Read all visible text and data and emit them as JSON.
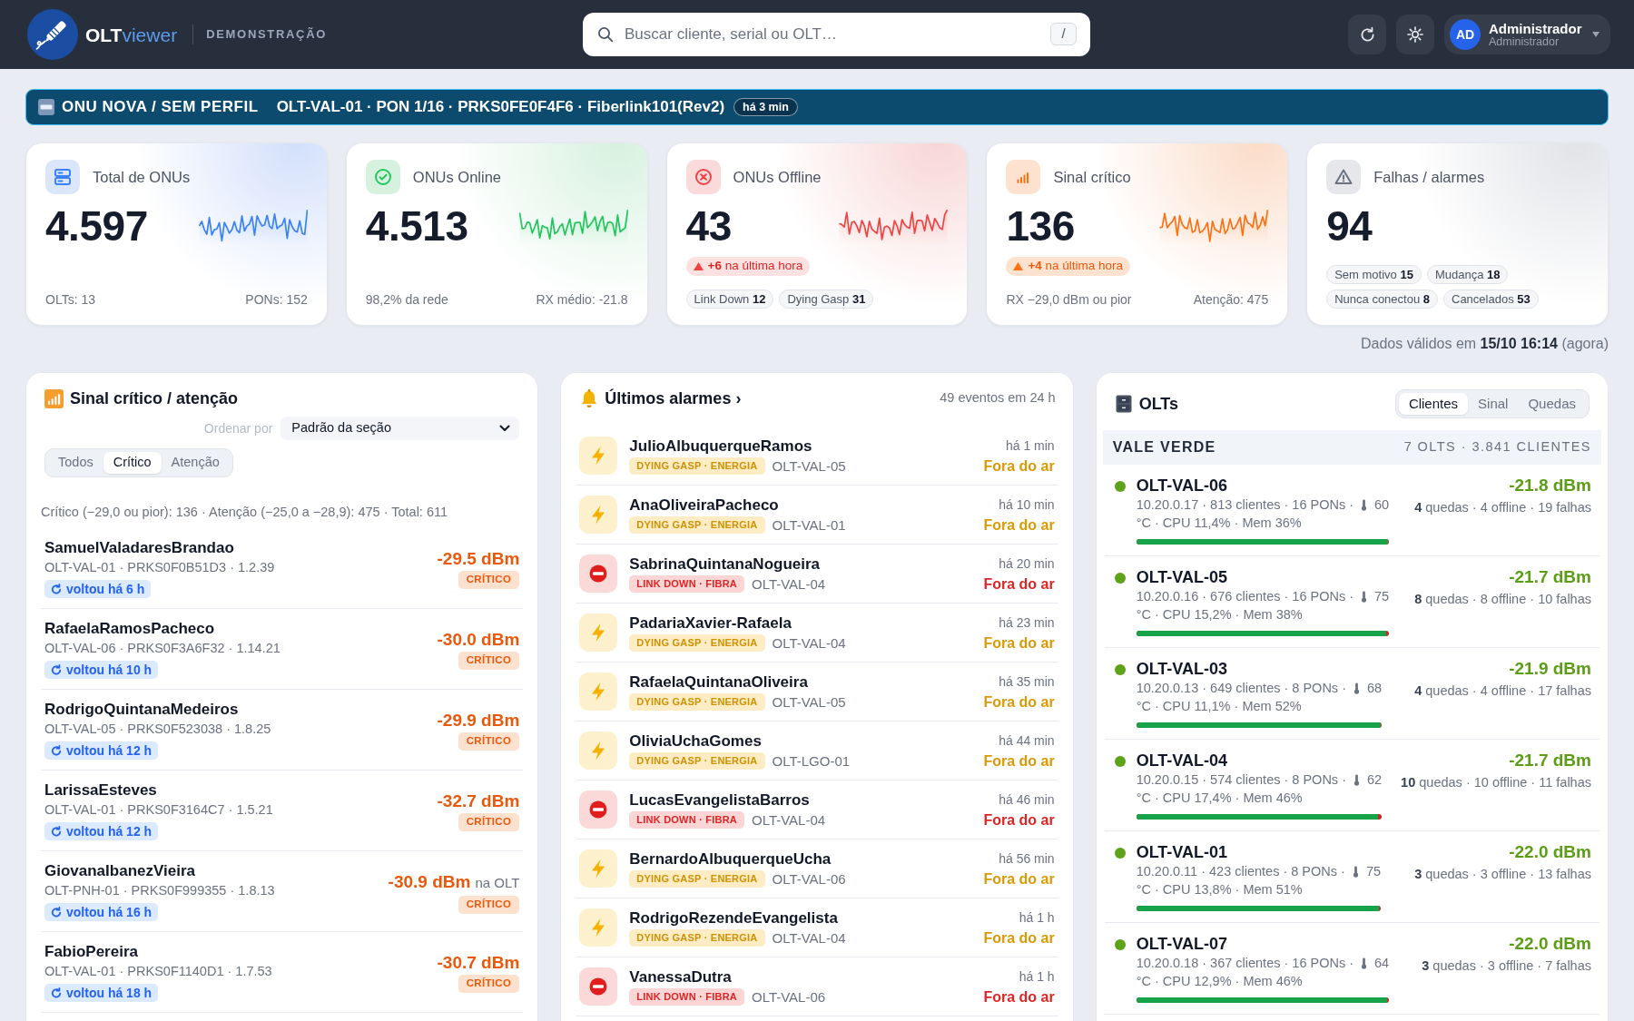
{
  "header": {
    "brand": {
      "name": "OLT",
      "suffix": "viewer"
    },
    "environment": "DEMONSTRAÇÃO",
    "search": {
      "placeholder": "Buscar cliente, serial ou OLT…",
      "shortcut": "/"
    },
    "user": {
      "initials": "AD",
      "name": "Administrador",
      "role": "Administrador"
    }
  },
  "banner": {
    "title": "ONU NOVA / SEM PERFIL",
    "detail": "OLT-VAL-01 · PON 1/16 · PRKS0FE0F4F6 · Fiberlink101(Rev2)",
    "time": "há 3 min"
  },
  "cards": [
    {
      "kind": "total",
      "title": "Total de ONUs",
      "value": "4.597",
      "sparkline": true,
      "footer": [
        "OLTs: 13",
        "PONs: 152"
      ]
    },
    {
      "kind": "online",
      "title": "ONUs Online",
      "value": "4.513",
      "sparkline": true,
      "footer": [
        "98,2% da rede",
        "RX médio: -21.8"
      ]
    },
    {
      "kind": "offline",
      "title": "ONUs Offline",
      "value": "43",
      "sparkline": true,
      "trend": "**+6** na última hora",
      "chips": [
        "Link Down **12**",
        "Dying Gasp **31**"
      ]
    },
    {
      "kind": "signal",
      "title": "Sinal crítico",
      "value": "136",
      "sparkline": true,
      "trend": "**+4** na última hora",
      "footer": [
        "RX −29,0 dBm ou pior",
        "Atenção: 475"
      ]
    },
    {
      "kind": "alarms",
      "title": "Falhas / alarmes",
      "value": "94",
      "sparkline": false,
      "chips": [
        "Sem motivo **15**",
        "Mudança **18**",
        "Nunca conectou **8**",
        "Cancelados **53**"
      ]
    }
  ],
  "updated": "Dados válidos em **15/10 16:14** (agora)",
  "signal_panel": {
    "title": "Sinal crítico / atenção",
    "sort": {
      "label": "Ordenar por",
      "value": "Padrão da seção"
    },
    "filters": [
      {
        "label": "Todos",
        "selected": false
      },
      {
        "label": "Crítico",
        "selected": true
      },
      {
        "label": "Atenção",
        "selected": false
      }
    ],
    "summary": "Crítico (−29,0 ou pior): 136 · Atenção (−25,0 a −28,9): 475 · Total: 611",
    "rows": [
      {
        "name": "SamuelValadaresBrandao",
        "detail": "OLT-VAL-01 · PRKS0F0B51D3 · 1.2.39",
        "recovered": "voltou há 6 h",
        "signal": "-29.5 dBm",
        "severity": "CRÍTICO"
      },
      {
        "name": "RafaelaRamosPacheco",
        "detail": "OLT-VAL-06 · PRKS0F3A6F32 · 1.14.21",
        "recovered": "voltou há 10 h",
        "signal": "-30.0 dBm",
        "severity": "CRÍTICO"
      },
      {
        "name": "RodrigoQuintanaMedeiros",
        "detail": "OLT-VAL-05 · PRKS0F523038 · 1.8.25",
        "recovered": "voltou há 12 h",
        "signal": "-29.9 dBm",
        "severity": "CRÍTICO"
      },
      {
        "name": "LarissaEsteves",
        "detail": "OLT-VAL-01 · PRKS0F3164C7 · 1.5.21",
        "recovered": "voltou há 12 h",
        "signal": "-32.7 dBm",
        "severity": "CRÍTICO"
      },
      {
        "name": "GiovanaIbanezVieira",
        "detail": "OLT-PNH-01 · PRKS0F999355 · 1.8.13",
        "recovered": "voltou há 16 h",
        "signal": "-30.9 dBm",
        "note": "na OLT",
        "severity": "CRÍTICO"
      },
      {
        "name": "FabioPereira",
        "detail": "OLT-VAL-01 · PRKS0F1140D1 · 1.7.53",
        "recovered": "voltou há 18 h",
        "signal": "-30.7 dBm",
        "severity": "CRÍTICO"
      }
    ]
  },
  "alarms_panel": {
    "title": "Últimos alarmes ›",
    "count": "49 eventos em 24 h",
    "rows": [
      {
        "kind": "dying_gasp",
        "name": "JulioAlbuquerqueRamos",
        "tag": "DYING GASP · ENERGIA",
        "olt": "OLT-VAL-05",
        "time": "há 1 min",
        "status": "Fora do ar"
      },
      {
        "kind": "dying_gasp",
        "name": "AnaOliveiraPacheco",
        "tag": "DYING GASP · ENERGIA",
        "olt": "OLT-VAL-01",
        "time": "há 10 min",
        "status": "Fora do ar"
      },
      {
        "kind": "link_down",
        "name": "SabrinaQuintanaNogueira",
        "tag": "LINK DOWN · FIBRA",
        "olt": "OLT-VAL-04",
        "time": "há 20 min",
        "status": "Fora do ar"
      },
      {
        "kind": "dying_gasp",
        "name": "PadariaXavier-Rafaela",
        "tag": "DYING GASP · ENERGIA",
        "olt": "OLT-VAL-04",
        "time": "há 23 min",
        "status": "Fora do ar"
      },
      {
        "kind": "dying_gasp",
        "name": "RafaelaQuintanaOliveira",
        "tag": "DYING GASP · ENERGIA",
        "olt": "OLT-VAL-05",
        "time": "há 35 min",
        "status": "Fora do ar"
      },
      {
        "kind": "dying_gasp",
        "name": "OliviaUchaGomes",
        "tag": "DYING GASP · ENERGIA",
        "olt": "OLT-LGO-01",
        "time": "há 44 min",
        "status": "Fora do ar"
      },
      {
        "kind": "link_down",
        "name": "LucasEvangelistaBarros",
        "tag": "LINK DOWN · FIBRA",
        "olt": "OLT-VAL-04",
        "time": "há 46 min",
        "status": "Fora do ar"
      },
      {
        "kind": "dying_gasp",
        "name": "BernardoAlbuquerqueUcha",
        "tag": "DYING GASP · ENERGIA",
        "olt": "OLT-VAL-06",
        "time": "há 56 min",
        "status": "Fora do ar"
      },
      {
        "kind": "dying_gasp",
        "name": "RodrigoRezendeEvangelista",
        "tag": "DYING GASP · ENERGIA",
        "olt": "OLT-VAL-04",
        "time": "há 1 h",
        "status": "Fora do ar"
      },
      {
        "kind": "link_down",
        "name": "VanessaDutra",
        "tag": "LINK DOWN · FIBRA",
        "olt": "OLT-VAL-06",
        "time": "há 1 h",
        "status": "Fora do ar"
      }
    ]
  },
  "olt_panel": {
    "title": "OLTs",
    "tabs": [
      {
        "label": "Clientes",
        "selected": true
      },
      {
        "label": "Sinal",
        "selected": false
      },
      {
        "label": "Quedas",
        "selected": false
      }
    ],
    "group": {
      "name": "VALE VERDE",
      "summary": "7 OLTS · 3.841 CLIENTES"
    },
    "olts": [
      {
        "name": "OLT-VAL-06",
        "online": true,
        "info": "10.20.0.17 · 813 clientes · 16 PONs ·",
        "temperature": "60",
        "load": "°C · CPU 11,4% · Mem 36%",
        "signal": "-21.8 dBm",
        "stats": "**4** quedas · 4 offline · 19 falhas",
        "level": 0.995
      },
      {
        "name": "OLT-VAL-05",
        "online": true,
        "info": "10.20.0.16 · 676 clientes · 16 PONs ·",
        "temperature": "75",
        "load": "°C · CPU 15,2% · Mem 38%",
        "signal": "-21.7 dBm",
        "stats": "**8** quedas · 8 offline · 10 falhas",
        "level": 0.988
      },
      {
        "name": "OLT-VAL-03",
        "online": true,
        "info": "10.20.0.13 · 649 clientes · 8 PONs ·",
        "temperature": "68",
        "load": "°C · CPU 11,1% · Mem 52%",
        "signal": "-21.9 dBm",
        "stats": "**4** quedas · 4 offline · 17 falhas",
        "level": 0.994
      },
      {
        "name": "OLT-VAL-04",
        "online": true,
        "info": "10.20.0.15 · 574 clientes · 8 PONs ·",
        "temperature": "62",
        "load": "°C · CPU 17,4% · Mem 46%",
        "signal": "-21.7 dBm",
        "stats": "**10** quedas · 10 offline · 11 falhas",
        "level": 0.983
      },
      {
        "name": "OLT-VAL-01",
        "online": true,
        "info": "10.20.0.11 · 423 clientes · 8 PONs ·",
        "temperature": "75",
        "load": "°C · CPU 13,8% · Mem 51%",
        "signal": "-22.0 dBm",
        "stats": "**3** quedas · 3 offline · 13 falhas",
        "level": 0.993
      },
      {
        "name": "OLT-VAL-07",
        "online": true,
        "info": "10.20.0.18 · 367 clientes · 16 PONs ·",
        "temperature": "64",
        "load": "°C · CPU 12,9% · Mem 46%",
        "signal": "-22.0 dBm",
        "stats": "**3** quedas · 3 offline · 7 falhas",
        "level": 0.992
      }
    ]
  }
}
